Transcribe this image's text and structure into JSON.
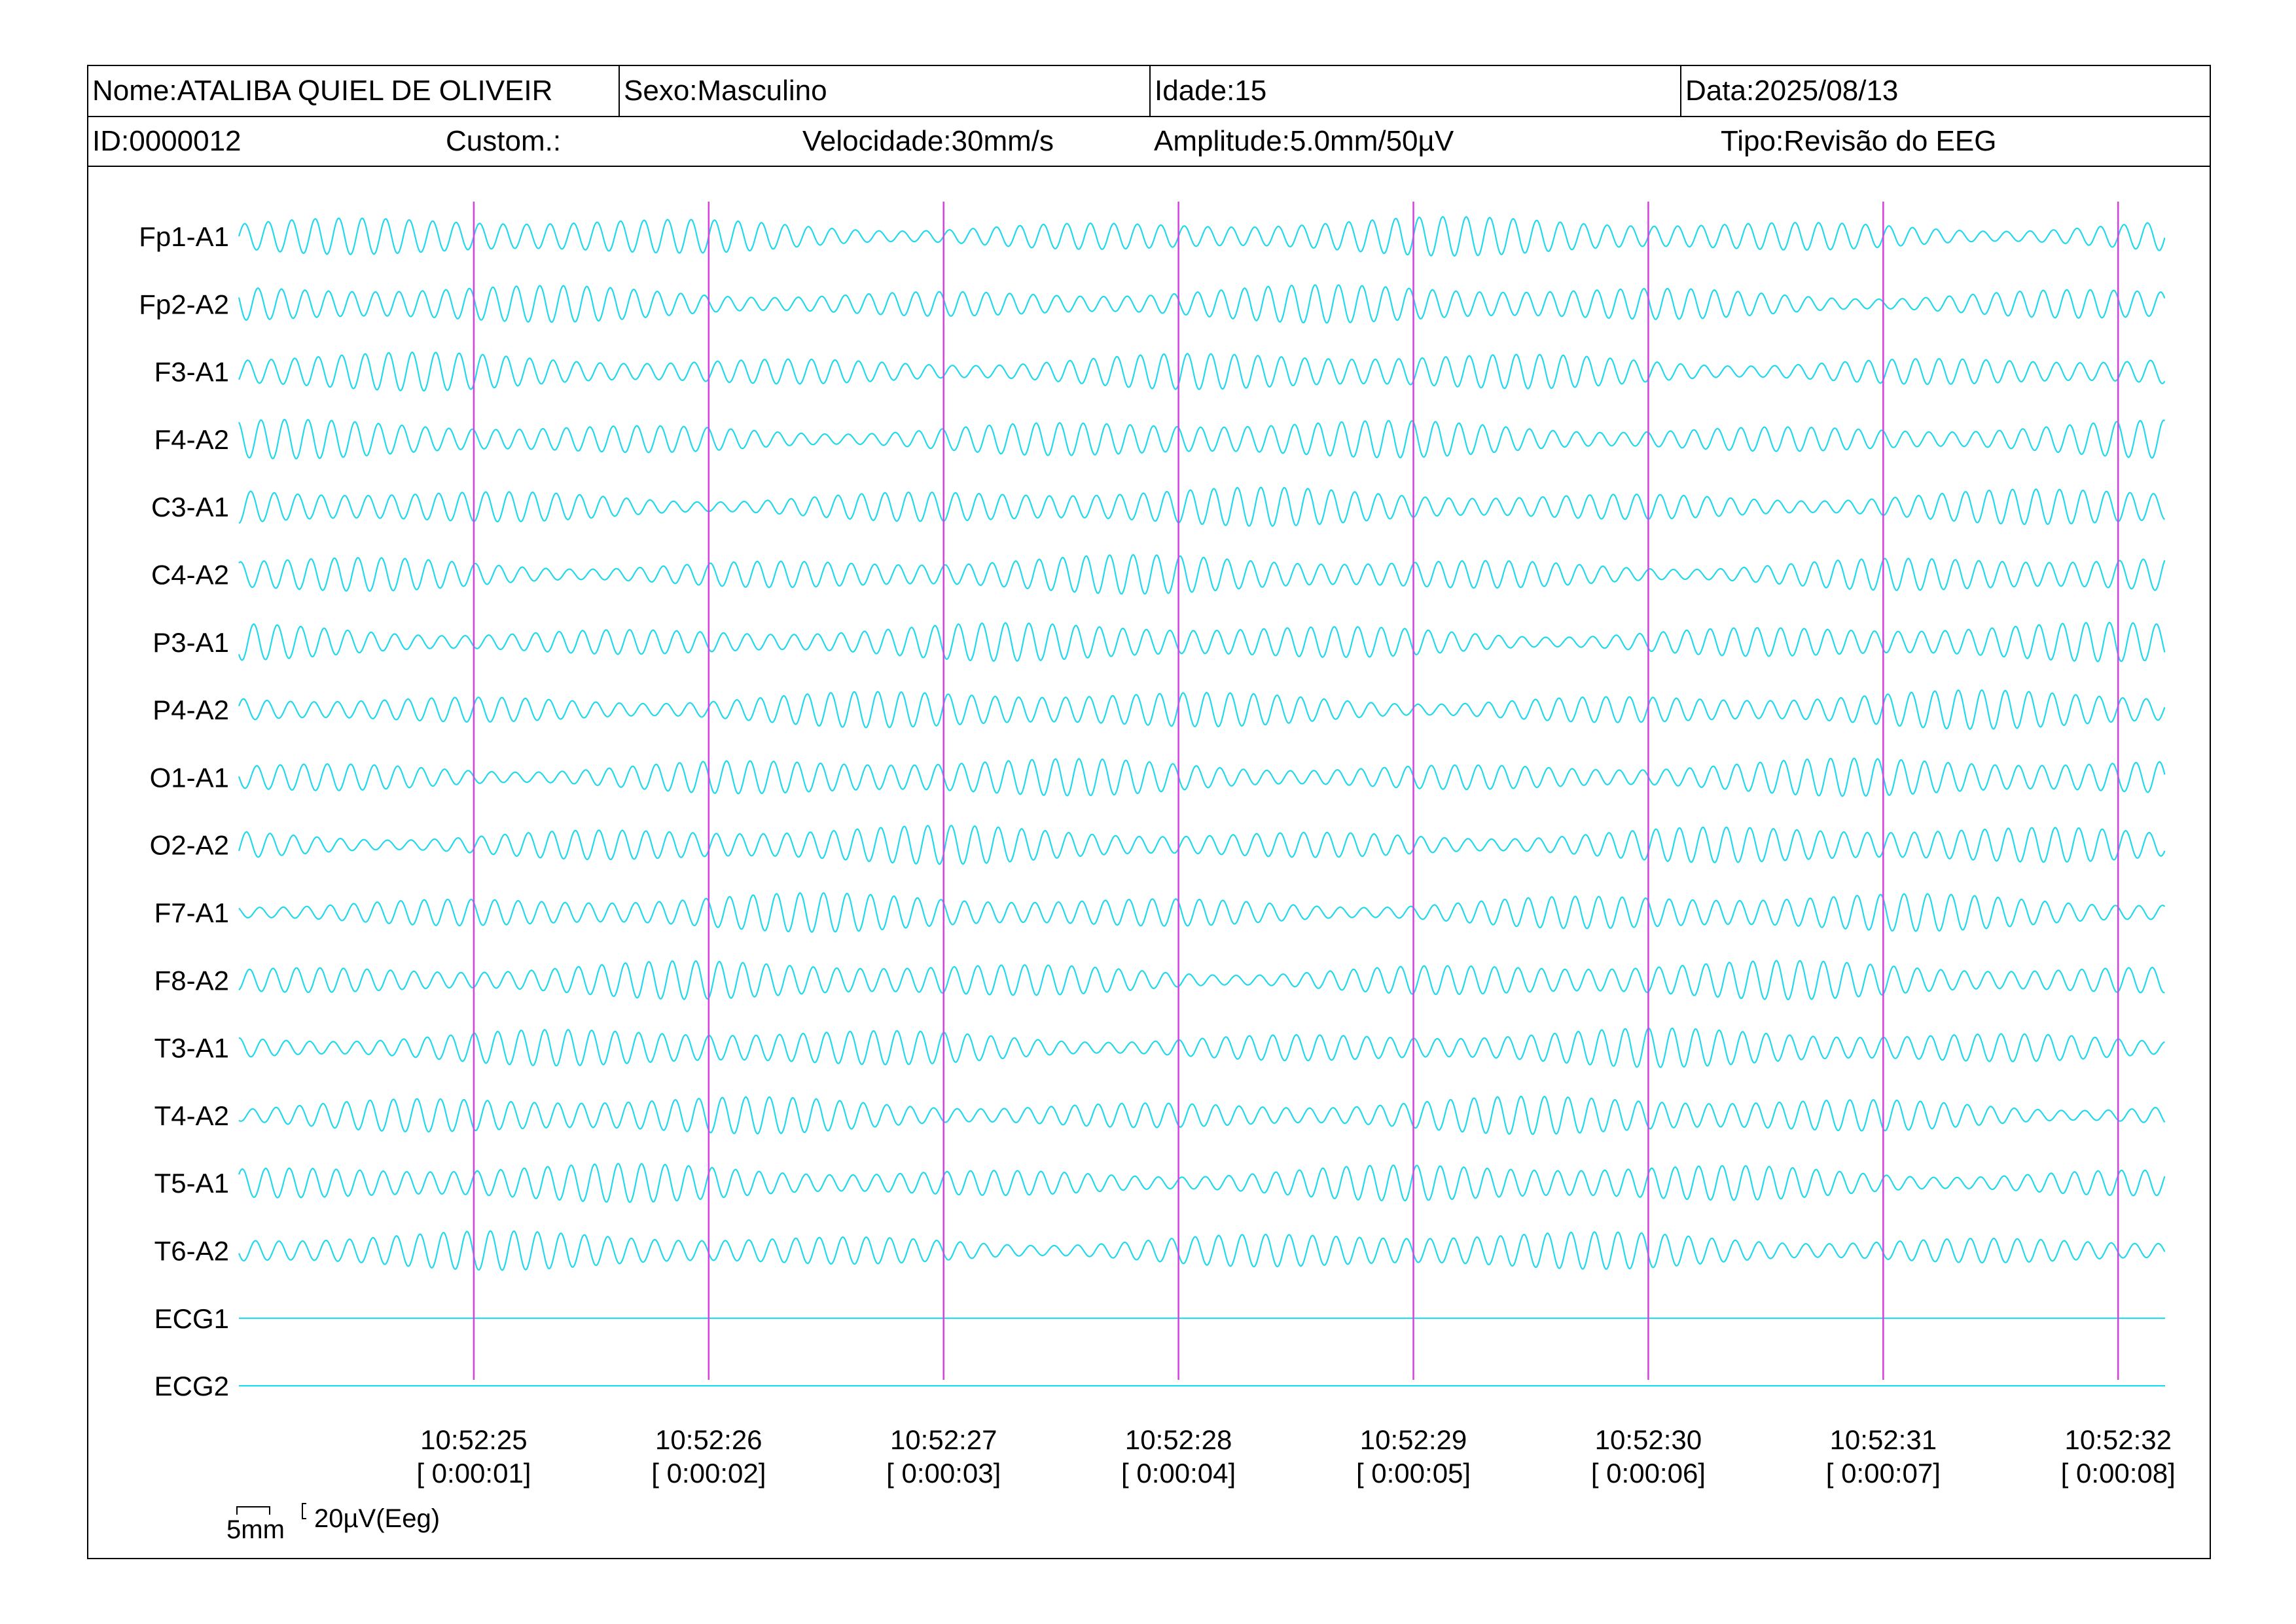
{
  "header": {
    "name": "Nome:ATALIBA QUIEL DE OLIVEIR",
    "sex": "Sexo:Masculino",
    "age": "Idade:15",
    "date": "Data:2025/08/13",
    "id": "ID:0000012",
    "custom": "Custom.:",
    "speed": "Velocidade:30mm/s",
    "amplitude": "Amplitude:5.0mm/50µV",
    "type": "Tipo:Revisão do EEG"
  },
  "scale": {
    "time_label": "5mm",
    "amp_label": "20µV(Eeg)"
  },
  "colors": {
    "trace": "#22d8ec",
    "marker": "#d63fe0",
    "border": "#000000"
  },
  "chart_data": {
    "type": "line",
    "title": "",
    "channels": [
      "Fp1-A1",
      "Fp2-A2",
      "F3-A1",
      "F4-A2",
      "C3-A1",
      "C4-A2",
      "P3-A1",
      "P4-A2",
      "O1-A1",
      "O2-A2",
      "F7-A1",
      "F8-A2",
      "T3-A1",
      "T4-A2",
      "T5-A1",
      "T6-A2",
      "ECG1",
      "ECG2"
    ],
    "flat_channels": [
      "ECG1",
      "ECG2"
    ],
    "duration_s": 8.2,
    "oscillation_hz": 10,
    "time_markers": [
      {
        "clock": "10:52:25",
        "elapsed": "[ 0:00:01]",
        "t": 1
      },
      {
        "clock": "10:52:26",
        "elapsed": "[ 0:00:02]",
        "t": 2
      },
      {
        "clock": "10:52:27",
        "elapsed": "[ 0:00:03]",
        "t": 3
      },
      {
        "clock": "10:52:28",
        "elapsed": "[ 0:00:04]",
        "t": 4
      },
      {
        "clock": "10:52:29",
        "elapsed": "[ 0:00:05]",
        "t": 5
      },
      {
        "clock": "10:52:30",
        "elapsed": "[ 0:00:06]",
        "t": 6
      },
      {
        "clock": "10:52:31",
        "elapsed": "[ 0:00:07]",
        "t": 7
      },
      {
        "clock": "10:52:32",
        "elapsed": "[ 0:00:08]",
        "t": 8
      }
    ],
    "grid": false,
    "legend": "none"
  }
}
